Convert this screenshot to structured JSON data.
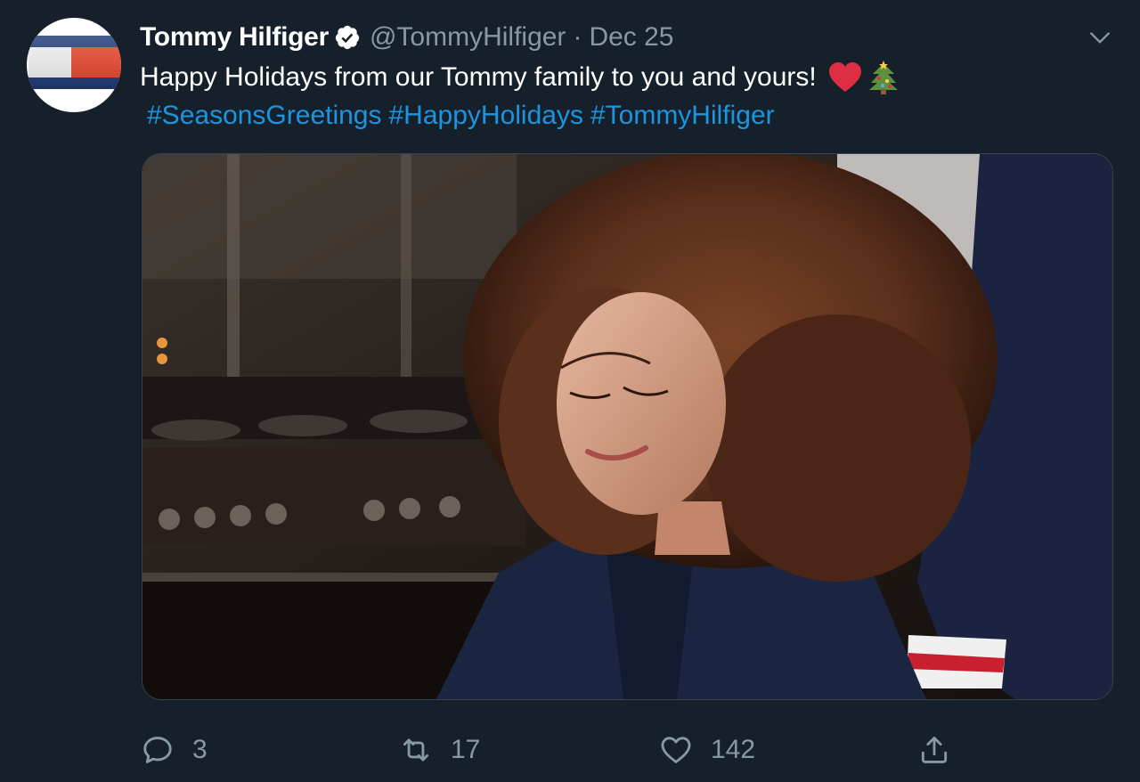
{
  "tweet": {
    "author_name": "Tommy Hilfiger",
    "author_handle": "@TommyHilfiger",
    "separator": "·",
    "date": "Dec 25",
    "text": "Happy Holidays from our Tommy family to you and yours!",
    "emojis": [
      "red-heart",
      "christmas-tree"
    ],
    "hashtags": [
      "#SeasonsGreetings",
      "#HappyHolidays",
      "#TommyHilfiger"
    ]
  },
  "actions": {
    "reply_count": "3",
    "retweet_count": "17",
    "like_count": "142"
  },
  "colors": {
    "background": "#15202b",
    "secondary_text": "#8899a6",
    "link": "#1b95e0",
    "border": "#38444d"
  },
  "icons": [
    "verified-badge-icon",
    "chevron-down-icon",
    "reply-icon",
    "retweet-icon",
    "like-icon",
    "share-icon"
  ]
}
